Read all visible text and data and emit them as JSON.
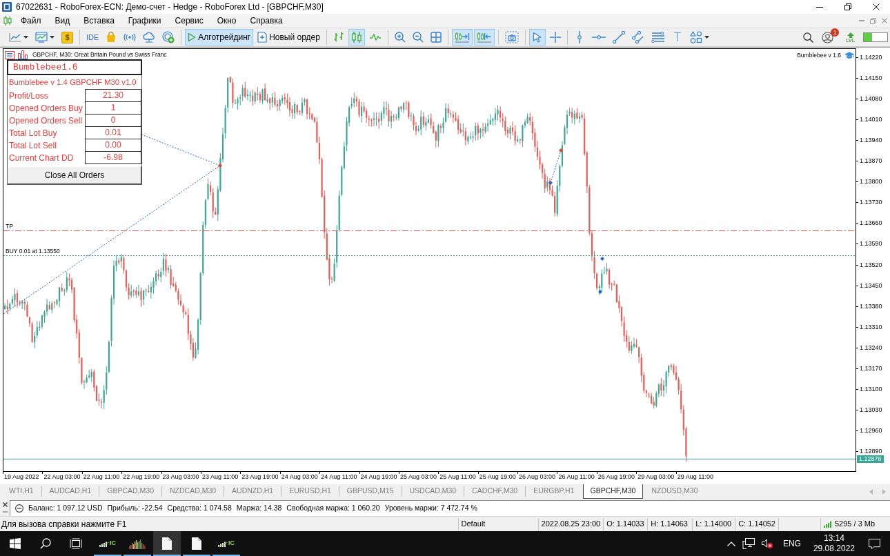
{
  "window": {
    "title": "67022631 - RoboForex-ECN: Демо-счет - Hedge - RoboForex Ltd - [GBPCHF,M30]"
  },
  "menu": [
    "Файл",
    "Вид",
    "Вставка",
    "Графики",
    "Сервис",
    "Окно",
    "Справка"
  ],
  "toolbar": {
    "groups": [
      [
        {
          "kind": "menu",
          "selected": false
        },
        {
          "kind": "menu",
          "selected": false
        },
        {
          "kind": "text",
          "label": "$",
          "selected": false
        }
      ],
      [
        {
          "kind": "text",
          "label": "IDE",
          "selected": false
        },
        {
          "kind": "icon",
          "selected": false
        },
        {
          "kind": "icon",
          "selected": false
        },
        {
          "kind": "icon",
          "selected": false
        },
        {
          "kind": "icon",
          "selected": false
        }
      ],
      [
        {
          "kind": "labeled",
          "label": "Алготрейдинг",
          "selected": true
        },
        {
          "kind": "labeled",
          "label": "Новый ордер",
          "selected": false
        }
      ],
      [
        {
          "kind": "icon",
          "selected": false
        },
        {
          "kind": "icon",
          "selected": true
        },
        {
          "kind": "icon",
          "selected": false
        }
      ],
      [
        {
          "kind": "icon",
          "selected": false
        },
        {
          "kind": "icon",
          "selected": false
        },
        {
          "kind": "icon",
          "selected": false
        }
      ],
      [
        {
          "kind": "icon",
          "selected": true
        },
        {
          "kind": "icon",
          "selected": true
        }
      ],
      [
        {
          "kind": "icon",
          "selected": false
        }
      ],
      [
        {
          "kind": "icon",
          "selected": true
        },
        {
          "kind": "icon",
          "selected": false
        }
      ],
      [
        {
          "kind": "icon",
          "selected": false
        },
        {
          "kind": "icon",
          "selected": false
        },
        {
          "kind": "icon",
          "selected": false
        },
        {
          "kind": "icon",
          "selected": false
        },
        {
          "kind": "icon",
          "selected": false
        },
        {
          "kind": "text",
          "label": "T",
          "selected": false
        },
        {
          "kind": "menu",
          "selected": false
        }
      ]
    ],
    "notifications": "1",
    "level_label": "LVL",
    "meter": {
      "level": 0.35
    }
  },
  "chart": {
    "title": "GBPCHF, M30: Great Britain Pound vs Swiss Franc",
    "expert": "Bumblebee v 1.6",
    "panel": {
      "title": "Bumblebee1.6",
      "subtitle": "Bumblebee v 1.4 GBPCHF M30 v1.0",
      "rows": [
        {
          "label": "Profit/Loss",
          "value": "21.30"
        },
        {
          "label": "Opened Orders Buy",
          "value": "1"
        },
        {
          "label": "Opened Orders Sell",
          "value": "0"
        },
        {
          "label": "Total Lot Buy",
          "value": "0.01"
        },
        {
          "label": "Total Lot Sell",
          "value": "0.00"
        },
        {
          "label": "Current Chart DD",
          "value": "-6.98"
        }
      ],
      "button": "Close All Orders"
    },
    "lines": [
      {
        "kind": "take-profit",
        "label": "TP"
      },
      {
        "kind": "order",
        "label": "BUY 0.01 at 1.13550"
      }
    ],
    "price_axis": [
      "1.14220",
      "1.14150",
      "1.14080",
      "1.14010",
      "1.13940",
      "1.13870",
      "1.13800",
      "1.13730",
      "1.13660",
      "1.13590",
      "1.13520",
      "1.13450",
      "1.13380",
      "1.13310",
      "1.13240",
      "1.13170",
      "1.13100",
      "1.13030",
      "1.12960",
      "1.12890"
    ],
    "current_price": "1.12876",
    "time_axis": [
      "19 Aug 2022",
      "22 Aug 03:00",
      "22 Aug 11:00",
      "22 Aug 19:00",
      "23 Aug 03:00",
      "23 Aug 11:00",
      "23 Aug 19:00",
      "24 Aug 03:00",
      "24 Aug 11:00",
      "24 Aug 19:00",
      "25 Aug 03:00",
      "25 Aug 11:00",
      "25 Aug 19:00",
      "26 Aug 03:00",
      "26 Aug 11:00",
      "26 Aug 19:00",
      "29 Aug 03:00",
      "29 Aug 11:00"
    ]
  },
  "chart_tabs": [
    {
      "label": "WTI,H1",
      "selected": false
    },
    {
      "label": "AUDCAD,H1",
      "selected": false
    },
    {
      "label": "GBPCAD,M30",
      "selected": false
    },
    {
      "label": "NZDCAD,M30",
      "selected": false
    },
    {
      "label": "AUDNZD,H1",
      "selected": false
    },
    {
      "label": "EURUSD,H1",
      "selected": false
    },
    {
      "label": "GBPUSD,M15",
      "selected": false
    },
    {
      "label": "USDCAD,M30",
      "selected": false
    },
    {
      "label": "CADCHF,M30",
      "selected": false
    },
    {
      "label": "EURGBP,H1",
      "selected": false
    },
    {
      "label": "GBPCHF,M30",
      "selected": true
    },
    {
      "label": "NZDUSD,M30",
      "selected": false
    }
  ],
  "account": [
    "Баланс: 1 097.12 USD",
    "Прибыль: -22.54",
    "Средства: 1 074.58",
    "Маржа: 14.38",
    "Свободная маржа: 1 060.20",
    "Уровень маржи: 7 472.74 %"
  ],
  "status_bar": {
    "help": "Для вызова справки нажмите F1",
    "profile": "Default",
    "datetime": "2022.08.25 23:00",
    "open": "O: 1.14033",
    "high": "H: 1.14063",
    "low": "L: 1.14000",
    "close": "C: 1.14052",
    "traffic": "5295 / 3 Mb"
  },
  "taskbar": {
    "apps": [
      {
        "kind": "logo",
        "label": "IC",
        "running": true,
        "selected": false
      },
      {
        "kind": "chart",
        "running": true,
        "selected": false
      },
      {
        "kind": "document",
        "running": true,
        "selected": true
      },
      {
        "kind": "document",
        "running": true,
        "selected": false
      },
      {
        "kind": "logo",
        "label": "IC",
        "running": true,
        "selected": false
      }
    ],
    "language": "ENG",
    "time": "13:14",
    "date": "29.08.2022"
  }
}
